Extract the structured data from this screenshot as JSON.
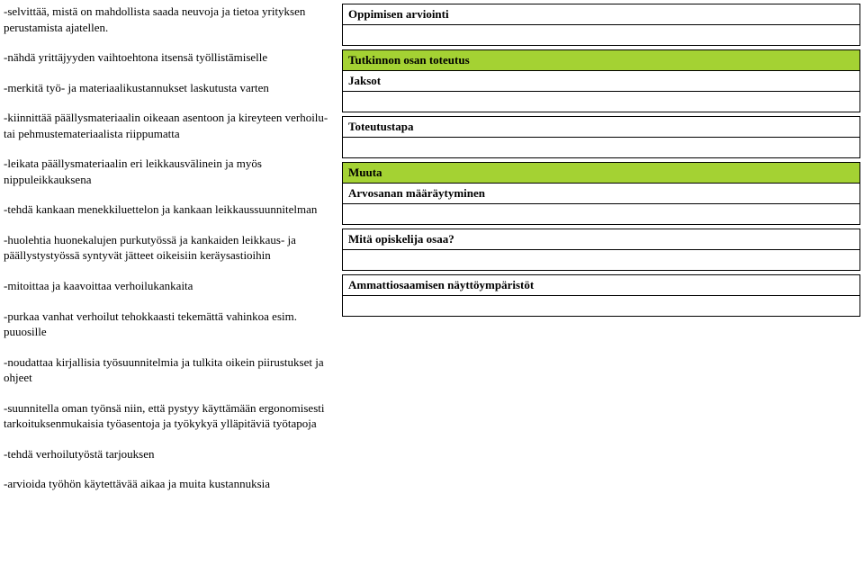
{
  "left": {
    "p1": "-selvittää, mistä on mahdollista saada neuvoja ja tietoa yrityksen perustamista ajatellen.",
    "p2": "-nähdä yrittäjyyden vaihtoehtona itsensä työllistämiselle",
    "p3": "-merkitä työ- ja materiaalikustannukset laskutusta varten",
    "p4": "-kiinnittää päällysmateriaalin oikeaan asentoon ja kireyteen verhoilu- tai pehmustemateriaalista riippumatta",
    "p5": "-leikata päällysmateriaalin eri leikkausvälinein ja myös nippuleikkauksena",
    "p6": "-tehdä kankaan menekkiluettelon ja kankaan leikkaussuunnitelman",
    "p7": "-huolehtia huonekalujen purkutyössä ja kankaiden leikkaus- ja päällystystyössä syntyvät jätteet oikeisiin keräysastioihin",
    "p8": "-mitoittaa ja kaavoittaa verhoilukankaita",
    "p9": "-purkaa vanhat verhoilut tehokkaasti tekemättä vahinkoa esim. puuosille",
    "p10": "-noudattaa kirjallisia työsuunnitelmia ja tulkita oikein piirustukset ja ohjeet",
    "p11": "-suunnitella oman työnsä niin, että pystyy käyttämään ergonomisesti tarkoituksenmukaisia työasentoja ja työkykyä ylläpitäviä työtapoja",
    "p12": "-tehdä verhoilutyöstä tarjouksen",
    "p13": "-arvioida työhön käytettävää aikaa ja muita kustannuksia"
  },
  "right": {
    "s1": "Oppimisen arviointi",
    "s2": "Tutkinnon osan toteutus",
    "s3": "Jaksot",
    "s4": "Toteutustapa",
    "s5": "Muuta",
    "s6": "Arvosanan määräytyminen",
    "s7": "Mitä opiskelija osaa?",
    "s8": "Ammattiosaamisen näyttöympäristöt"
  }
}
